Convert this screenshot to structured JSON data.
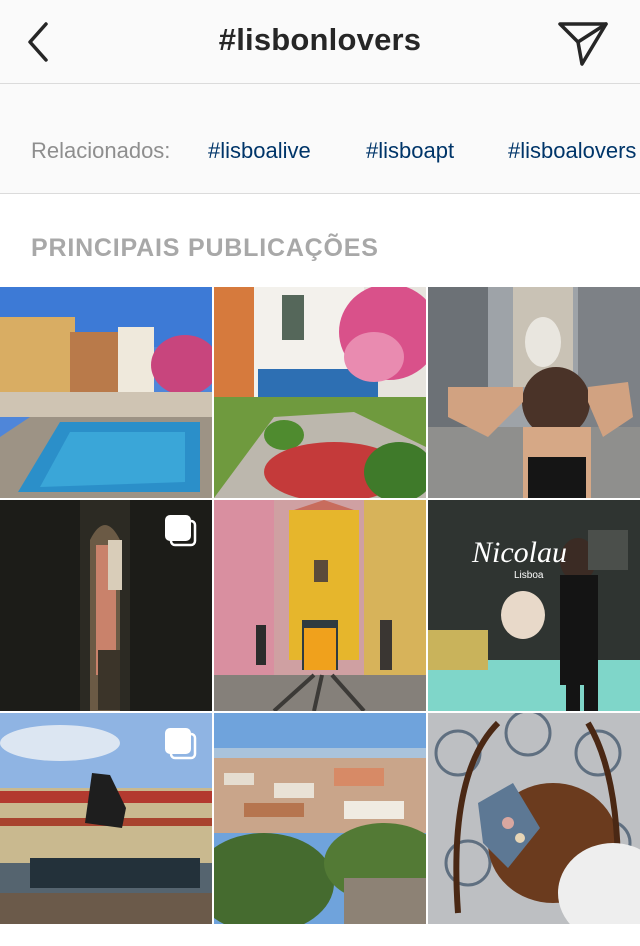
{
  "header": {
    "title": "#lisbonlovers",
    "back_icon": "chevron-left-icon",
    "send_icon": "paper-plane-icon"
  },
  "related": {
    "label": "Relacionados:",
    "tags": [
      "#lisboalive",
      "#lisboapt",
      "#lisboalovers"
    ]
  },
  "section": {
    "title": "PRINCIPAIS PUBLICAÇÕES"
  },
  "posts": [
    {
      "subject": "rooftop pool with city view",
      "multiple": false
    },
    {
      "subject": "tiled garden with flowering tree",
      "multiple": false
    },
    {
      "subject": "woman on street near arch",
      "multiple": false
    },
    {
      "subject": "dark archway alley",
      "multiple": true
    },
    {
      "subject": "yellow tram on street",
      "multiple": false
    },
    {
      "subject": "woman in front of cafe sign",
      "multiple": false,
      "sign_text": "Nicolau",
      "sign_subtext": "Lisboa"
    },
    {
      "subject": "bullring with bull statue",
      "multiple": true
    },
    {
      "subject": "city panorama from viewpoint",
      "multiple": false
    },
    {
      "subject": "bag on chair over patterned tiles",
      "multiple": false
    }
  ],
  "colors": {
    "tag": "#003569",
    "muted": "#8e8e8e",
    "divider": "#dbdbdb"
  }
}
